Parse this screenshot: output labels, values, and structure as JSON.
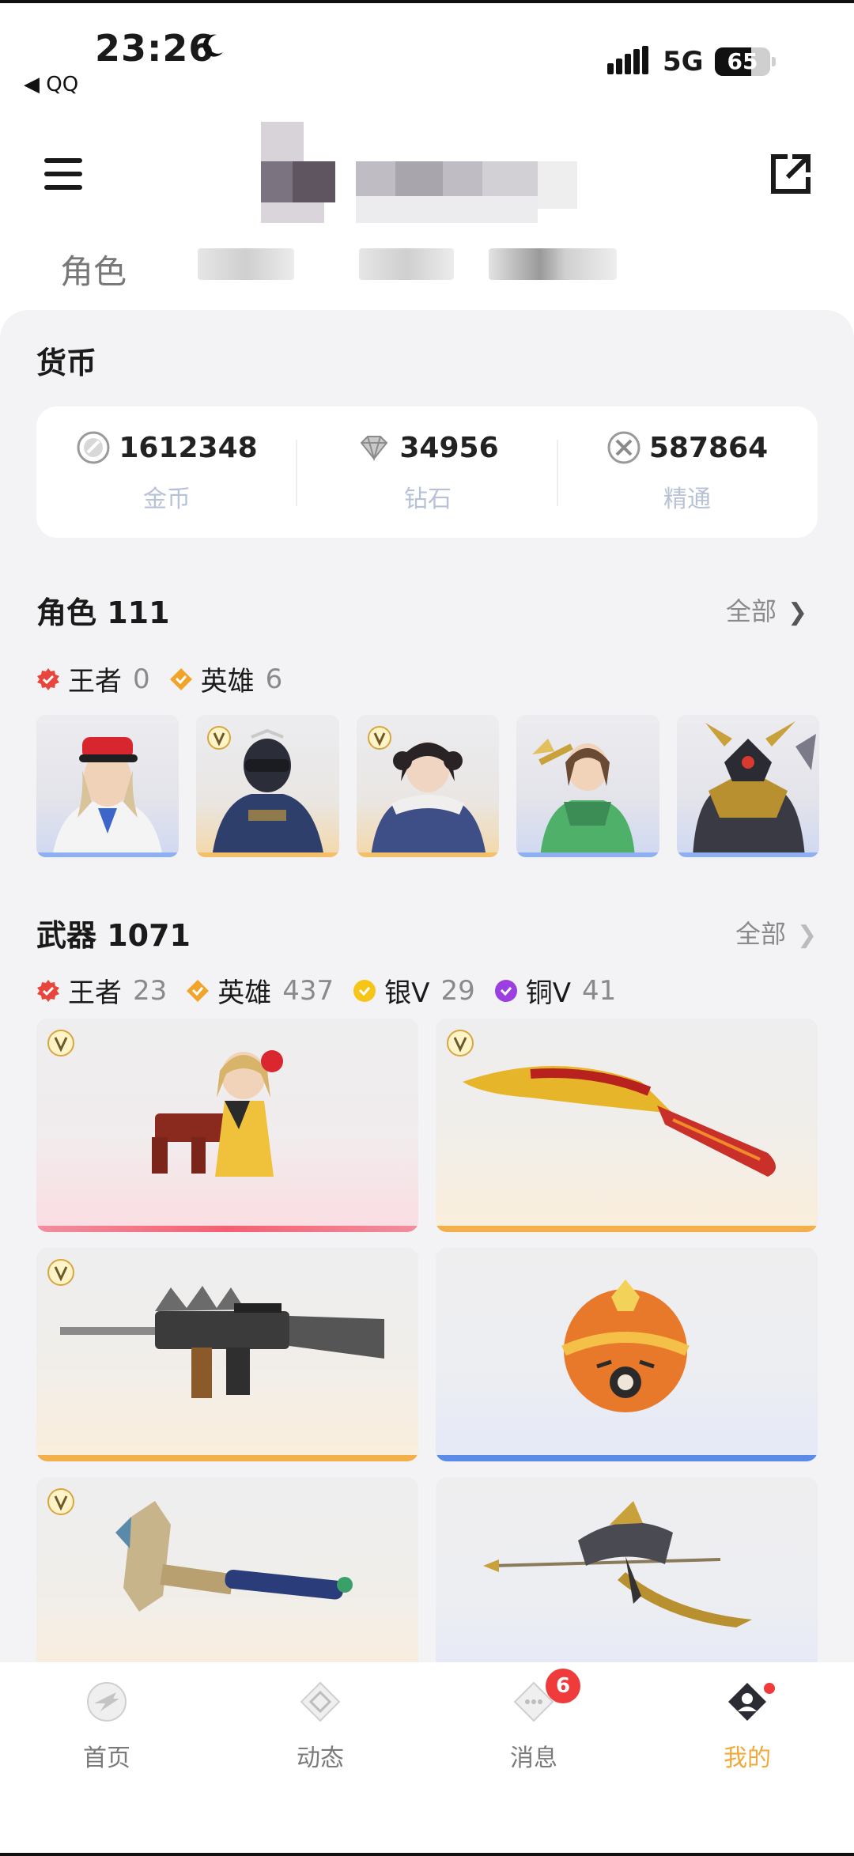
{
  "status_bar": {
    "time": "23:26",
    "back_app": "◀ QQ",
    "network": "5G",
    "battery": "65",
    "battery_level": 0.65
  },
  "header": {
    "menu_icon": "hamburger-icon",
    "share_icon": "external-share-icon"
  },
  "tabs": {
    "role_tab": "角色"
  },
  "currency": {
    "title": "货币",
    "items": [
      {
        "value": "1612348",
        "label": "金币",
        "icon": "coin-icon"
      },
      {
        "value": "34956",
        "label": "钻石",
        "icon": "diamond-icon"
      },
      {
        "value": "587864",
        "label": "精通",
        "icon": "mastery-icon"
      }
    ]
  },
  "roles": {
    "title": "角色 111",
    "more": "全部",
    "badges": [
      {
        "label": "王者",
        "count": "0",
        "color": "#e8453c"
      },
      {
        "label": "英雄",
        "count": "6",
        "color": "#f2a32a"
      }
    ]
  },
  "weapons": {
    "title": "武器 1071",
    "more": "全部",
    "badges": [
      {
        "label": "王者",
        "count": "23",
        "color": "#e8453c"
      },
      {
        "label": "英雄",
        "count": "437",
        "color": "#f2a32a"
      },
      {
        "label": "银V",
        "count": "29",
        "color": "#f5c518"
      },
      {
        "label": "铜V",
        "count": "41",
        "color": "#9b3fe0"
      }
    ]
  },
  "bottom_nav": {
    "items": [
      {
        "label": "首页",
        "icon": "home-icon"
      },
      {
        "label": "动态",
        "icon": "feed-icon"
      },
      {
        "label": "消息",
        "icon": "message-icon"
      },
      {
        "label": "我的",
        "icon": "profile-icon"
      }
    ],
    "message_badge": "6"
  },
  "colors": {
    "accent": "#f2a93b",
    "badge_red": "#ef3b3b",
    "panel_bg": "#f3f3f5"
  }
}
